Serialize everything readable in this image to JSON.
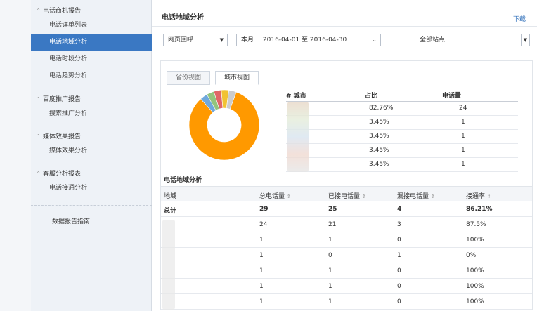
{
  "sidebar": {
    "groups": [
      {
        "label": "电话商机报告",
        "items": [
          {
            "label": "电话详单列表"
          },
          {
            "label": "电话地域分析",
            "active": true
          },
          {
            "label": "电话时段分析"
          },
          {
            "label": "电话趋势分析"
          }
        ]
      },
      {
        "label": "百度推广报告",
        "items": [
          {
            "label": "搜索推广分析"
          }
        ]
      },
      {
        "label": "媒体效果报告",
        "items": [
          {
            "label": "媒体效果分析"
          }
        ]
      },
      {
        "label": "客服分析报表",
        "items": [
          {
            "label": "电话接通分析"
          }
        ]
      }
    ],
    "guide": "数据报告指南"
  },
  "header": {
    "title": "电话地域分析",
    "download": "下载"
  },
  "filters": {
    "type": "网页回呼",
    "date_label": "本月",
    "date_range": "2016-04-01 至 2016-04-30",
    "site": "全部站点"
  },
  "tabs": [
    {
      "label": "省份视图"
    },
    {
      "label": "城市视图",
      "active": true
    }
  ],
  "pie": {
    "colors": [
      "#ff9900",
      "#6fa8dc",
      "#93c47d",
      "#e06666",
      "#f1c232",
      "#cccccc"
    ],
    "shares": [
      82.76,
      3.45,
      3.45,
      3.45,
      3.45,
      3.45
    ]
  },
  "city_table": {
    "headers": [
      "# 城市",
      "占比",
      "电话量"
    ],
    "rows": [
      {
        "pct": "82.76%",
        "count": "24"
      },
      {
        "pct": "3.45%",
        "count": "1"
      },
      {
        "pct": "3.45%",
        "count": "1"
      },
      {
        "pct": "3.45%",
        "count": "1"
      },
      {
        "pct": "3.45%",
        "count": "1"
      }
    ]
  },
  "section_title": "电话地域分析",
  "detail_table": {
    "headers": [
      "地域",
      "总电话量",
      "已接电话量",
      "漏接电话量",
      "接通率"
    ],
    "total": {
      "region": "总计",
      "total": "29",
      "answered": "25",
      "missed": "4",
      "rate": "86.21%"
    },
    "rows": [
      {
        "total": "24",
        "answered": "21",
        "missed": "3",
        "rate": "87.5%"
      },
      {
        "total": "1",
        "answered": "1",
        "missed": "0",
        "rate": "100%"
      },
      {
        "total": "1",
        "answered": "0",
        "missed": "1",
        "rate": "0%"
      },
      {
        "total": "1",
        "answered": "1",
        "missed": "0",
        "rate": "100%"
      },
      {
        "total": "1",
        "answered": "1",
        "missed": "0",
        "rate": "100%"
      },
      {
        "total": "1",
        "answered": "1",
        "missed": "0",
        "rate": "100%"
      }
    ]
  }
}
